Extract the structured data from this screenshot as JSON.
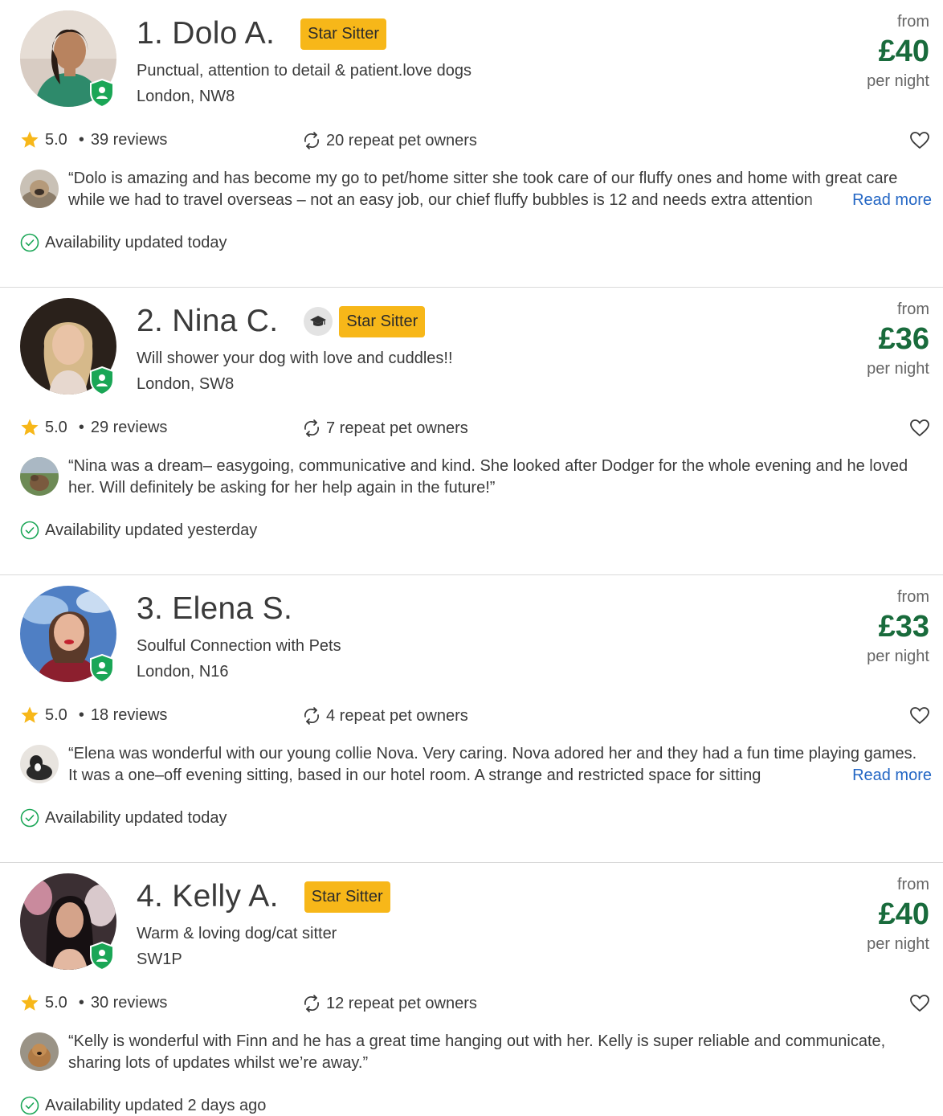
{
  "colors": {
    "star_badge": "#f7b719",
    "price": "#196b3c",
    "link": "#2366c4",
    "verified": "#1aa656",
    "rating_star": "#f7b719"
  },
  "labels": {
    "price_from": "from",
    "price_unit": "per night",
    "read_more": "Read more",
    "star_sitter": "Star Sitter"
  },
  "sitters": [
    {
      "name": "1. Dolo A.",
      "has_grad_icon": false,
      "star_sitter": true,
      "tagline": "Punctual, attention to detail & patient.love dogs",
      "location": "London, NW8",
      "price": "£40",
      "rating": "5.0",
      "reviews": "39 reviews",
      "repeat_owners": "20 repeat pet owners",
      "review_text": "“Dolo is amazing and has become my go to pet/home sitter she took care of our fluffy ones and home with great care while we had to travel overseas – not an easy job, our chief fluffy bubbles is 12 and needs extra attention",
      "truncated": true,
      "availability": "Availability updated today"
    },
    {
      "name": "2. Nina C.",
      "has_grad_icon": true,
      "star_sitter": true,
      "tagline": "Will shower your dog with love and cuddles!!",
      "location": "London, SW8",
      "price": "£36",
      "rating": "5.0",
      "reviews": "29 reviews",
      "repeat_owners": "7 repeat pet owners",
      "review_text": "“Nina was a dream– easygoing, communicative and kind. She looked after Dodger for the whole evening and he loved her. Will definitely be asking for her help again in the future!”",
      "truncated": false,
      "availability": "Availability updated yesterday"
    },
    {
      "name": "3. Elena S.",
      "has_grad_icon": false,
      "star_sitter": false,
      "tagline": "Soulful Connection with Pets",
      "location": "London, N16",
      "price": "£33",
      "rating": "5.0",
      "reviews": "18 reviews",
      "repeat_owners": "4 repeat pet owners",
      "review_text": "“Elena was wonderful with our young collie Nova. Very caring. Nova adored her and they had a fun time playing games. It was a one–off evening sitting, based in our hotel room. A strange and restricted space for sitting",
      "truncated": true,
      "availability": "Availability updated today"
    },
    {
      "name": "4. Kelly A.",
      "has_grad_icon": false,
      "star_sitter": true,
      "tagline": "Warm & loving dog/cat sitter",
      "location": "SW1P",
      "price": "£40",
      "rating": "5.0",
      "reviews": "30 reviews",
      "repeat_owners": "12 repeat pet owners",
      "review_text": "“Kelly is wonderful with Finn and he has a great time hanging out with her. Kelly is super reliable and communicate, sharing lots of updates whilst we’re away.”",
      "truncated": false,
      "availability": "Availability updated 2 days ago"
    }
  ]
}
